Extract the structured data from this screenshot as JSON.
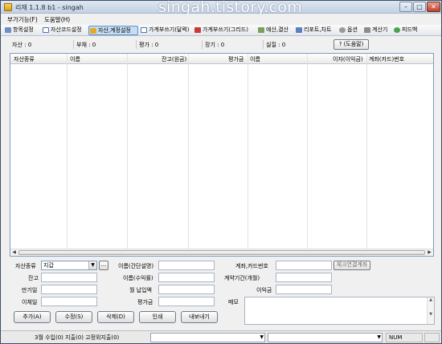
{
  "window": {
    "title": "리재 1.1.8 b1 - singah",
    "watermark": "singah.tistory.com",
    "controls": {
      "minimize": "–",
      "maximize": "□",
      "close": "✕"
    }
  },
  "menu": {
    "items": [
      "부가기능(F)",
      "도움말(H)"
    ]
  },
  "toolbar": {
    "tabs": [
      "항목설정",
      "자산코드설정",
      "자산,계정설정",
      "가계부쓰기(달력)",
      "가계부쓰기(그리드)",
      "예산,결산",
      "리포트,차트",
      "옵션",
      "계산기",
      "피드백"
    ],
    "active_tab": "자산,계정설정"
  },
  "summary": {
    "asset": "자산 : 0",
    "debt": "부채 : 0",
    "valuation": "평가 : 0",
    "long_term": "장기 : 0",
    "net": "실질 : 0",
    "help_button": "? (도움말)"
  },
  "grid": {
    "columns": [
      "자산종류",
      "이름",
      "잔고(원금)",
      "평가금",
      "이름",
      "이자(이익금)",
      "계좌(카드)번호"
    ],
    "rows": []
  },
  "form": {
    "asset_type_label": "자산종류",
    "asset_type_value": "지갑",
    "browse_button": "...",
    "balance_label": "잔고",
    "maturity_label": "만기일",
    "transfer_date_label": "이체일",
    "name_simple_label": "이름(간단설명)",
    "name_profit_label": "이름(수익률)",
    "monthly_payment_label": "월 납입액",
    "valuation_label": "평가금",
    "account_no_label": "계좌,카드번호",
    "check_link_button": "체크연결계좌",
    "contract_period_label": "계약기간(개월)",
    "interest_label": "이익금",
    "memo_label": "메모"
  },
  "actions": {
    "add": "추가(A)",
    "edit": "수정(S)",
    "delete": "삭제(D)",
    "print": "인쇄",
    "export": "내보내기"
  },
  "status": {
    "text": "3월 수입(0) 지출(0) 고정외지출(0)",
    "numlock": "NUM"
  },
  "colors": {
    "active_tab_bg": "#c7ddf3",
    "titlebar_bg": "#c3d1e3",
    "close_button": "#c0412a"
  }
}
